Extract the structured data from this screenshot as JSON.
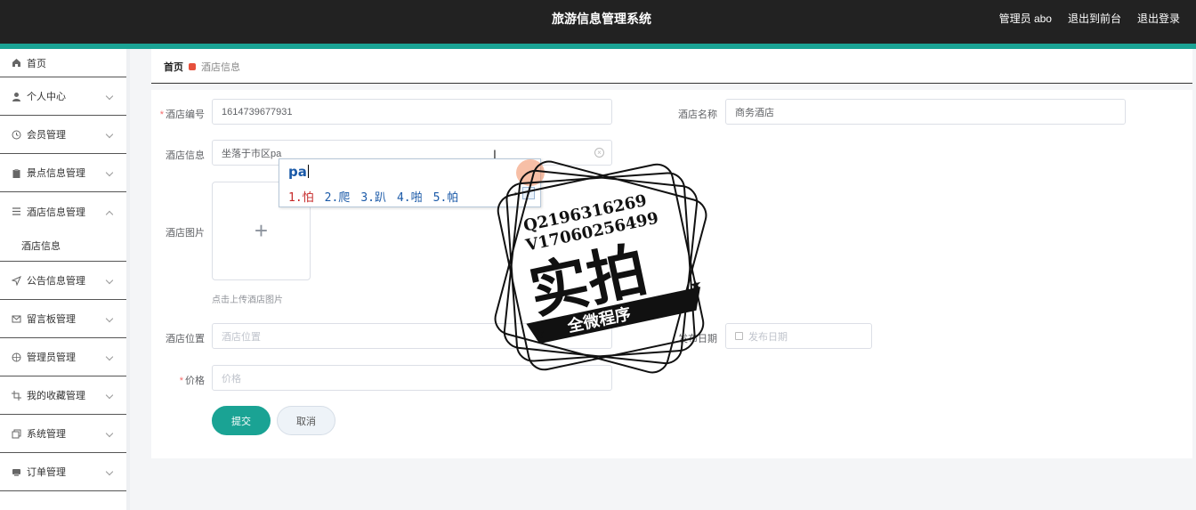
{
  "header": {
    "title": "旅游信息管理系统",
    "user": "管理员 abo",
    "back_to_front": "退出到前台",
    "logout": "退出登录"
  },
  "sidebar": {
    "items": [
      {
        "label": "首页",
        "icon": "home-icon"
      },
      {
        "label": "个人中心",
        "icon": "user-icon"
      },
      {
        "label": "会员管理",
        "icon": "clock-icon"
      },
      {
        "label": "景点信息管理",
        "icon": "clipboard-icon"
      },
      {
        "label": "酒店信息管理",
        "icon": "list-icon",
        "expanded": true,
        "children": [
          "酒店信息"
        ]
      },
      {
        "label": "公告信息管理",
        "icon": "send-icon"
      },
      {
        "label": "留言板管理",
        "icon": "mail-icon"
      },
      {
        "label": "管理员管理",
        "icon": "compass-icon"
      },
      {
        "label": "我的收藏管理",
        "icon": "crop-icon"
      },
      {
        "label": "系统管理",
        "icon": "copy-icon"
      },
      {
        "label": "订单管理",
        "icon": "printer-icon"
      }
    ]
  },
  "breadcrumb": {
    "home": "首页",
    "current": "酒店信息"
  },
  "form": {
    "hotel_code": {
      "label": "酒店编号",
      "value": "1614739677931"
    },
    "hotel_name": {
      "label": "酒店名称",
      "value": "商务酒店"
    },
    "hotel_info": {
      "label": "酒店信息",
      "value": "坐落于市区pa"
    },
    "hotel_image": {
      "label": "酒店图片",
      "tip": "点击上传酒店图片",
      "plus": "+"
    },
    "hotel_location": {
      "label": "酒店位置",
      "placeholder": "酒店位置"
    },
    "publish_date": {
      "label": "发布日期",
      "placeholder": "发布日期"
    },
    "price": {
      "label": "价格",
      "placeholder": "价格"
    },
    "submit": "提交",
    "cancel": "取消"
  },
  "ime": {
    "composition": "pa",
    "candidates": [
      "1.怕",
      "2.爬",
      "3.趴",
      "4.啪",
      "5.帕"
    ]
  },
  "watermark": {
    "line1": "Q2196316269",
    "line2": "V17060256499",
    "main": "实拍",
    "banner": "全微程序"
  },
  "colors": {
    "accent": "#1aa394",
    "topbar": "#222222",
    "required": "#f56c6c"
  }
}
